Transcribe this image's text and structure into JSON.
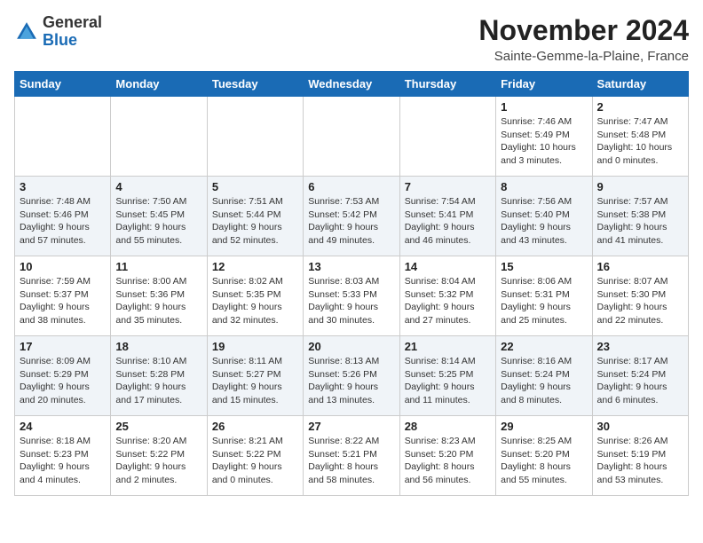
{
  "header": {
    "logo": {
      "general": "General",
      "blue": "Blue"
    },
    "title": "November 2024",
    "location": "Sainte-Gemme-la-Plaine, France"
  },
  "weekdays": [
    "Sunday",
    "Monday",
    "Tuesday",
    "Wednesday",
    "Thursday",
    "Friday",
    "Saturday"
  ],
  "weeks": [
    [
      {
        "day": "",
        "info": ""
      },
      {
        "day": "",
        "info": ""
      },
      {
        "day": "",
        "info": ""
      },
      {
        "day": "",
        "info": ""
      },
      {
        "day": "",
        "info": ""
      },
      {
        "day": "1",
        "info": "Sunrise: 7:46 AM\nSunset: 5:49 PM\nDaylight: 10 hours\nand 3 minutes."
      },
      {
        "day": "2",
        "info": "Sunrise: 7:47 AM\nSunset: 5:48 PM\nDaylight: 10 hours\nand 0 minutes."
      }
    ],
    [
      {
        "day": "3",
        "info": "Sunrise: 7:48 AM\nSunset: 5:46 PM\nDaylight: 9 hours\nand 57 minutes."
      },
      {
        "day": "4",
        "info": "Sunrise: 7:50 AM\nSunset: 5:45 PM\nDaylight: 9 hours\nand 55 minutes."
      },
      {
        "day": "5",
        "info": "Sunrise: 7:51 AM\nSunset: 5:44 PM\nDaylight: 9 hours\nand 52 minutes."
      },
      {
        "day": "6",
        "info": "Sunrise: 7:53 AM\nSunset: 5:42 PM\nDaylight: 9 hours\nand 49 minutes."
      },
      {
        "day": "7",
        "info": "Sunrise: 7:54 AM\nSunset: 5:41 PM\nDaylight: 9 hours\nand 46 minutes."
      },
      {
        "day": "8",
        "info": "Sunrise: 7:56 AM\nSunset: 5:40 PM\nDaylight: 9 hours\nand 43 minutes."
      },
      {
        "day": "9",
        "info": "Sunrise: 7:57 AM\nSunset: 5:38 PM\nDaylight: 9 hours\nand 41 minutes."
      }
    ],
    [
      {
        "day": "10",
        "info": "Sunrise: 7:59 AM\nSunset: 5:37 PM\nDaylight: 9 hours\nand 38 minutes."
      },
      {
        "day": "11",
        "info": "Sunrise: 8:00 AM\nSunset: 5:36 PM\nDaylight: 9 hours\nand 35 minutes."
      },
      {
        "day": "12",
        "info": "Sunrise: 8:02 AM\nSunset: 5:35 PM\nDaylight: 9 hours\nand 32 minutes."
      },
      {
        "day": "13",
        "info": "Sunrise: 8:03 AM\nSunset: 5:33 PM\nDaylight: 9 hours\nand 30 minutes."
      },
      {
        "day": "14",
        "info": "Sunrise: 8:04 AM\nSunset: 5:32 PM\nDaylight: 9 hours\nand 27 minutes."
      },
      {
        "day": "15",
        "info": "Sunrise: 8:06 AM\nSunset: 5:31 PM\nDaylight: 9 hours\nand 25 minutes."
      },
      {
        "day": "16",
        "info": "Sunrise: 8:07 AM\nSunset: 5:30 PM\nDaylight: 9 hours\nand 22 minutes."
      }
    ],
    [
      {
        "day": "17",
        "info": "Sunrise: 8:09 AM\nSunset: 5:29 PM\nDaylight: 9 hours\nand 20 minutes."
      },
      {
        "day": "18",
        "info": "Sunrise: 8:10 AM\nSunset: 5:28 PM\nDaylight: 9 hours\nand 17 minutes."
      },
      {
        "day": "19",
        "info": "Sunrise: 8:11 AM\nSunset: 5:27 PM\nDaylight: 9 hours\nand 15 minutes."
      },
      {
        "day": "20",
        "info": "Sunrise: 8:13 AM\nSunset: 5:26 PM\nDaylight: 9 hours\nand 13 minutes."
      },
      {
        "day": "21",
        "info": "Sunrise: 8:14 AM\nSunset: 5:25 PM\nDaylight: 9 hours\nand 11 minutes."
      },
      {
        "day": "22",
        "info": "Sunrise: 8:16 AM\nSunset: 5:24 PM\nDaylight: 9 hours\nand 8 minutes."
      },
      {
        "day": "23",
        "info": "Sunrise: 8:17 AM\nSunset: 5:24 PM\nDaylight: 9 hours\nand 6 minutes."
      }
    ],
    [
      {
        "day": "24",
        "info": "Sunrise: 8:18 AM\nSunset: 5:23 PM\nDaylight: 9 hours\nand 4 minutes."
      },
      {
        "day": "25",
        "info": "Sunrise: 8:20 AM\nSunset: 5:22 PM\nDaylight: 9 hours\nand 2 minutes."
      },
      {
        "day": "26",
        "info": "Sunrise: 8:21 AM\nSunset: 5:22 PM\nDaylight: 9 hours\nand 0 minutes."
      },
      {
        "day": "27",
        "info": "Sunrise: 8:22 AM\nSunset: 5:21 PM\nDaylight: 8 hours\nand 58 minutes."
      },
      {
        "day": "28",
        "info": "Sunrise: 8:23 AM\nSunset: 5:20 PM\nDaylight: 8 hours\nand 56 minutes."
      },
      {
        "day": "29",
        "info": "Sunrise: 8:25 AM\nSunset: 5:20 PM\nDaylight: 8 hours\nand 55 minutes."
      },
      {
        "day": "30",
        "info": "Sunrise: 8:26 AM\nSunset: 5:19 PM\nDaylight: 8 hours\nand 53 minutes."
      }
    ]
  ]
}
